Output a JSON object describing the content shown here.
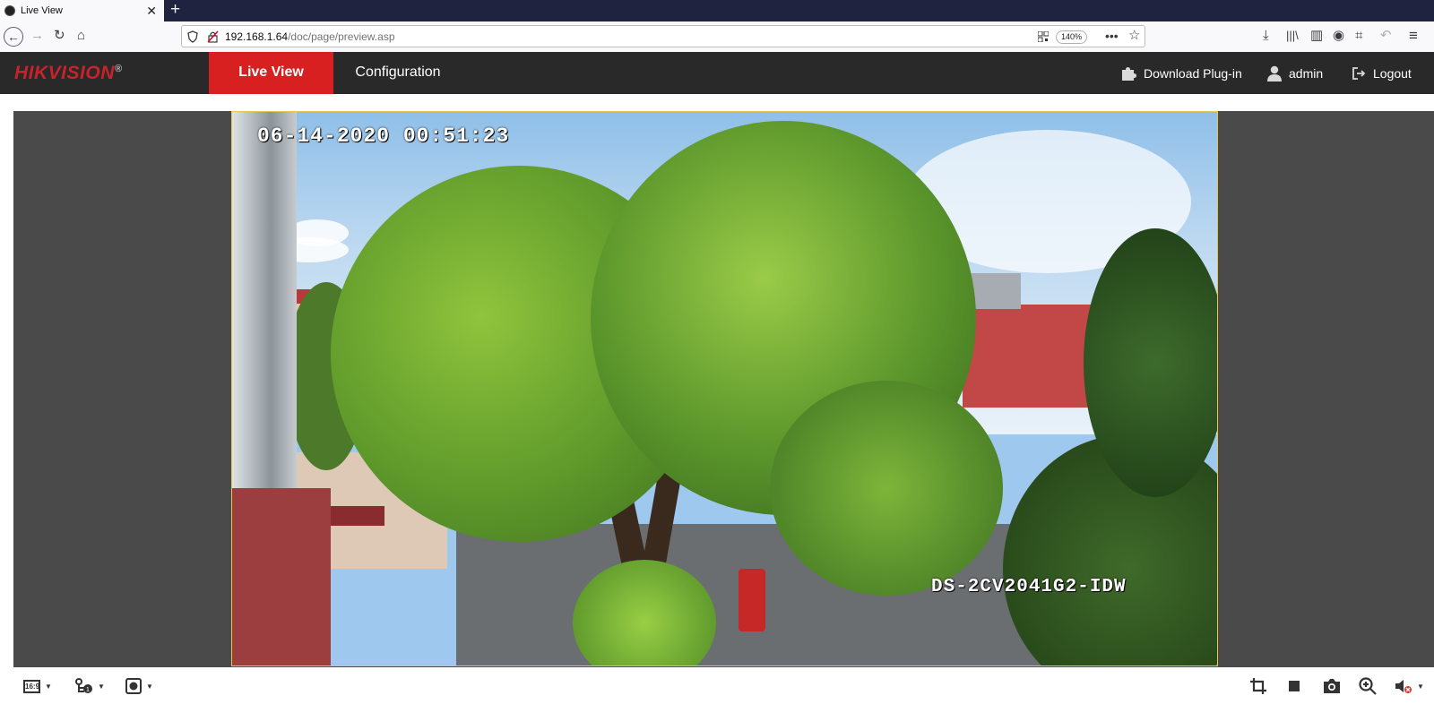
{
  "browser": {
    "tab_title": "Live View",
    "tab_close": "✕",
    "new_tab": "+",
    "url_host": "192.168.1.64",
    "url_path": "/doc/page/preview.asp",
    "zoom_level": "140%"
  },
  "header": {
    "logo_red": "HIK",
    "logo_rest": "VISION",
    "logo_mark": "®",
    "tabs": [
      {
        "label": "Live View",
        "active": true
      },
      {
        "label": "Configuration",
        "active": false
      }
    ],
    "download_plugin": "Download Plug-in",
    "user": "admin",
    "logout": "Logout"
  },
  "video": {
    "timestamp": "06-14-2020 00:51:23",
    "camera_model": "DS-2CV2041G2-IDW"
  },
  "toolbar": {
    "aspect_label": "16:9",
    "left_items": [
      "aspect-ratio",
      "stream-type",
      "plugin-type"
    ],
    "right_items": [
      "digital-zoom-crop",
      "stop",
      "capture",
      "zoom",
      "audio"
    ]
  },
  "colors": {
    "header_bg": "#292929",
    "active_tab": "#d82020",
    "brand_red": "#c8232b",
    "preview_bg": "#4a4a4a",
    "video_border": "#e6c84a"
  }
}
